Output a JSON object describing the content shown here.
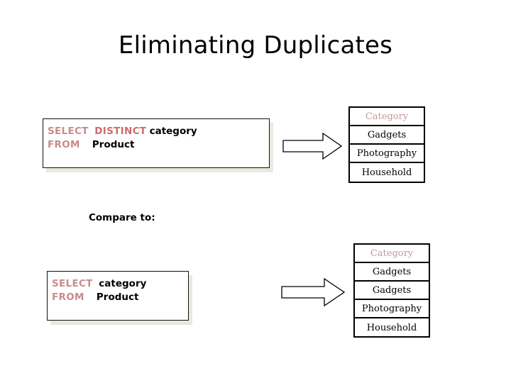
{
  "slide": {
    "title": "Eliminating Duplicates",
    "compare_label": "Compare to:",
    "background_color": "#ffffff"
  },
  "colors": {
    "keyword": "#c98b8b",
    "keyword_strong": "#d06a6a",
    "identifier": "#000000",
    "table_header": "#c49a9a",
    "border": "#000000",
    "shadow": "#ebe8dd"
  },
  "queries": [
    {
      "id": "distinct-query",
      "line1_keyword": "SELECT",
      "line1_keyword2": "DISTINCT",
      "line1_identifier": "category",
      "line2_keyword": "FROM",
      "line2_identifier": "Product",
      "full_text": "SELECT  DISTINCT category\nFROM    Product"
    },
    {
      "id": "plain-query",
      "line1_keyword": "SELECT",
      "line1_keyword2": "",
      "line1_identifier": "category",
      "line2_keyword": "FROM",
      "line2_identifier": "Product",
      "full_text": "SELECT  category\nFROM    Product"
    }
  ],
  "arrows": [
    {
      "id": "arrow-top",
      "direction": "right"
    },
    {
      "id": "arrow-bottom",
      "direction": "right"
    }
  ],
  "tables": [
    {
      "id": "distinct-result",
      "header": "Category",
      "rows": [
        "Gadgets",
        "Photography",
        "Household"
      ]
    },
    {
      "id": "plain-result",
      "header": "Category",
      "rows": [
        "Gadgets",
        "Gadgets",
        "Photography",
        "Household"
      ]
    }
  ]
}
